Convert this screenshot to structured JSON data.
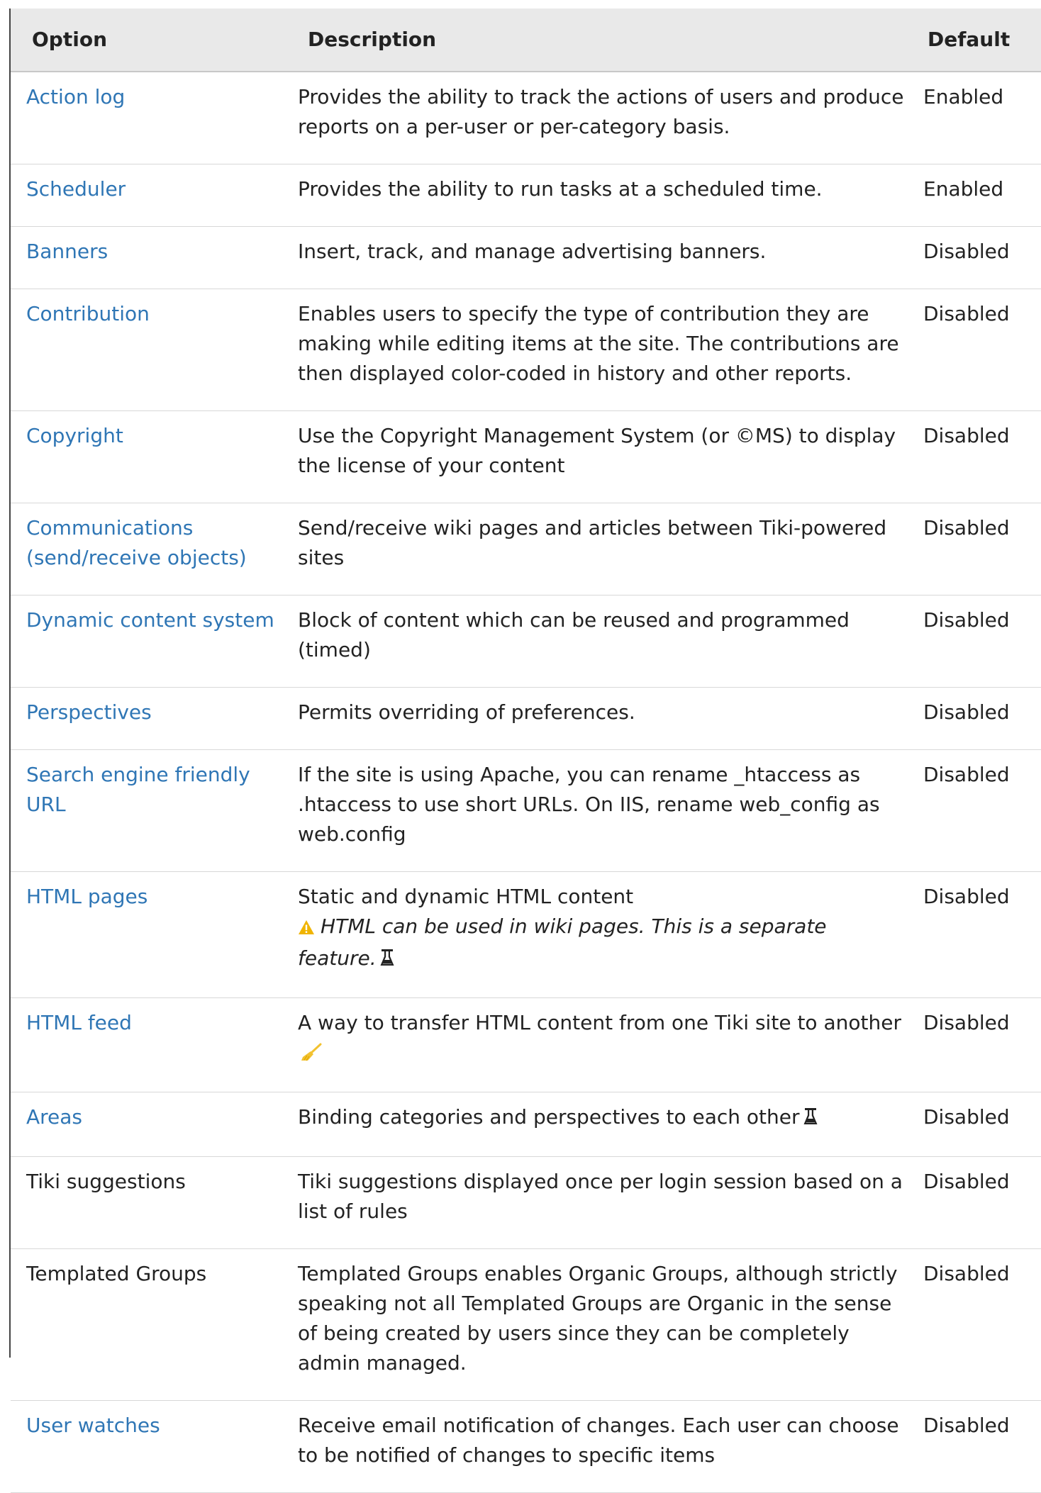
{
  "table": {
    "headers": {
      "option": "Option",
      "description": "Description",
      "default": "Default"
    },
    "rows": [
      {
        "option": "Action log",
        "is_link": true,
        "description": "Provides the ability to track the actions of users and produce reports on a per-user or per-category basis.",
        "default": "Enabled"
      },
      {
        "option": "Scheduler",
        "is_link": true,
        "description": "Provides the ability to run tasks at a scheduled time.",
        "default": "Enabled"
      },
      {
        "option": "Banners",
        "is_link": true,
        "description": "Insert, track, and manage advertising banners.",
        "default": "Disabled"
      },
      {
        "option": "Contribution",
        "is_link": true,
        "description": "Enables users to specify the type of contribution they are making while editing items at the site. The contributions are then displayed color-coded in history and other reports.",
        "default": "Disabled"
      },
      {
        "option": "Copyright",
        "is_link": true,
        "description": "Use the Copyright Management System (or ©MS) to display the license of your content",
        "default": "Disabled"
      },
      {
        "option": "Communications (send/receive objects)",
        "is_link": true,
        "description": "Send/receive wiki pages and articles between Tiki-powered sites",
        "default": "Disabled"
      },
      {
        "option": "Dynamic content system",
        "is_link": true,
        "description": "Block of content which can be reused and programmed (timed)",
        "default": "Disabled"
      },
      {
        "option": "Perspectives",
        "is_link": true,
        "description": "Permits overriding of preferences.",
        "default": "Disabled"
      },
      {
        "option": "Search engine friendly URL",
        "is_link": true,
        "description": "If the site is using Apache, you can rename _htaccess as .htaccess to use short URLs. On IIS, rename web_config as web.config",
        "default": "Disabled"
      },
      {
        "option": "HTML pages",
        "is_link": true,
        "description": "Static and dynamic HTML content",
        "note": "HTML can be used in wiki pages. This is a separate feature.",
        "default": "Disabled"
      },
      {
        "option": "HTML feed",
        "is_link": true,
        "description": "A way to transfer HTML content from one Tiki site to another",
        "default": "Disabled"
      },
      {
        "option": "Areas",
        "is_link": true,
        "description": "Binding categories and perspectives to each other",
        "default": "Disabled"
      },
      {
        "option": "Tiki suggestions",
        "is_link": false,
        "description": "Tiki suggestions displayed once per login session based on a list of rules",
        "default": "Disabled"
      },
      {
        "option": "Templated Groups",
        "is_link": false,
        "description": "Templated Groups enables Organic Groups, although strictly speaking not all Templated Groups are Organic in the sense of being created by users since they can be completely admin managed.",
        "default": "Disabled"
      },
      {
        "option": "User watches",
        "is_link": true,
        "description": "Receive email notification of changes. Each user can choose to be notified of changes to specific items",
        "default": "Disabled"
      }
    ]
  },
  "colors": {
    "link": "#2f76b5",
    "text": "#222222",
    "header_bg": "#e9e9e9",
    "warning": "#f0b400",
    "broom": "#f2c230"
  },
  "icons": {
    "warning": "warning-icon",
    "experimental": "flask-icon",
    "deprecated": "broom-icon"
  }
}
